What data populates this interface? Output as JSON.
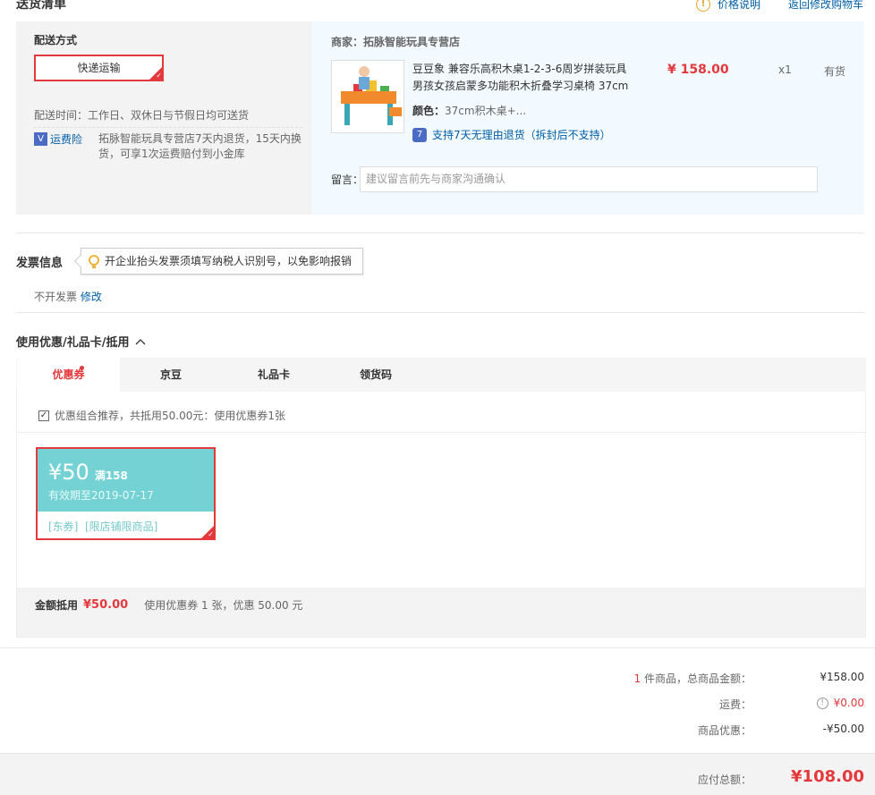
{
  "header": {
    "title": "送货清单",
    "price_note": "价格说明",
    "back_link": "返回修改购物车"
  },
  "shipping": {
    "method_label": "配送方式",
    "method_value": "快递运输",
    "time_text": "配送时间：工作日、双休日与节假日均可送货",
    "freight_label": "运费险",
    "freight_text_1": "拓脉智能玩具专营店7天内退货，15天内换",
    "freight_text_2": "货，可享1次运费赔付到小金库"
  },
  "shop": {
    "merchant_label": "商家：拓脉智能玩具专营店",
    "product_title_1": "豆豆象 兼容乐高积木桌1-2-3-6周岁拼装玩具",
    "product_title_2": "男孩女孩启蒙多功能积木折叠学习桌椅 37cm",
    "price": "¥ 158.00",
    "qty": "x1",
    "stock": "有货",
    "color_label": "颜色：",
    "color_value": "37cm积木桌+...",
    "return_icon": "7",
    "return_text": "支持7天无理由退货（拆封后不支持）",
    "message_label": "留言：",
    "message_placeholder": "建议留言前先与商家沟通确认"
  },
  "invoice": {
    "title": "发票信息",
    "tip": "开企业抬头发票须填写纳税人识别号，以免影响报销",
    "status": "不开发票",
    "edit": "修改"
  },
  "discount": {
    "title": "使用优惠/礼品卡/抵用",
    "tabs": [
      "优惠券",
      "京豆",
      "礼品卡",
      "领货码"
    ],
    "recommend_text": "优惠组合推荐，共抵用50.00元：使用优惠券1张",
    "coupon": {
      "amount": "¥50",
      "condition": "满158",
      "expiry": "有效期至2019-07-17",
      "tags": "[东券]  [限店铺限商品]"
    },
    "summary_label": "金额抵用",
    "summary_amount": "¥50.00",
    "summary_text": "使用优惠券 1 张，优惠 50.00 元"
  },
  "totals": {
    "count": "1",
    "count_label": " 件商品，总商品金额：",
    "subtotal": "¥158.00",
    "freight_label": "运费：",
    "freight_value": "¥0.00",
    "promo_label": "商品优惠：",
    "promo_value": "-¥50.00",
    "grand_label": "应付总额：",
    "grand_value": "¥108.00"
  },
  "colors": {
    "accent_red": "#e4393c",
    "link_blue": "#005ea7",
    "coupon_teal": "#74d2d4"
  }
}
